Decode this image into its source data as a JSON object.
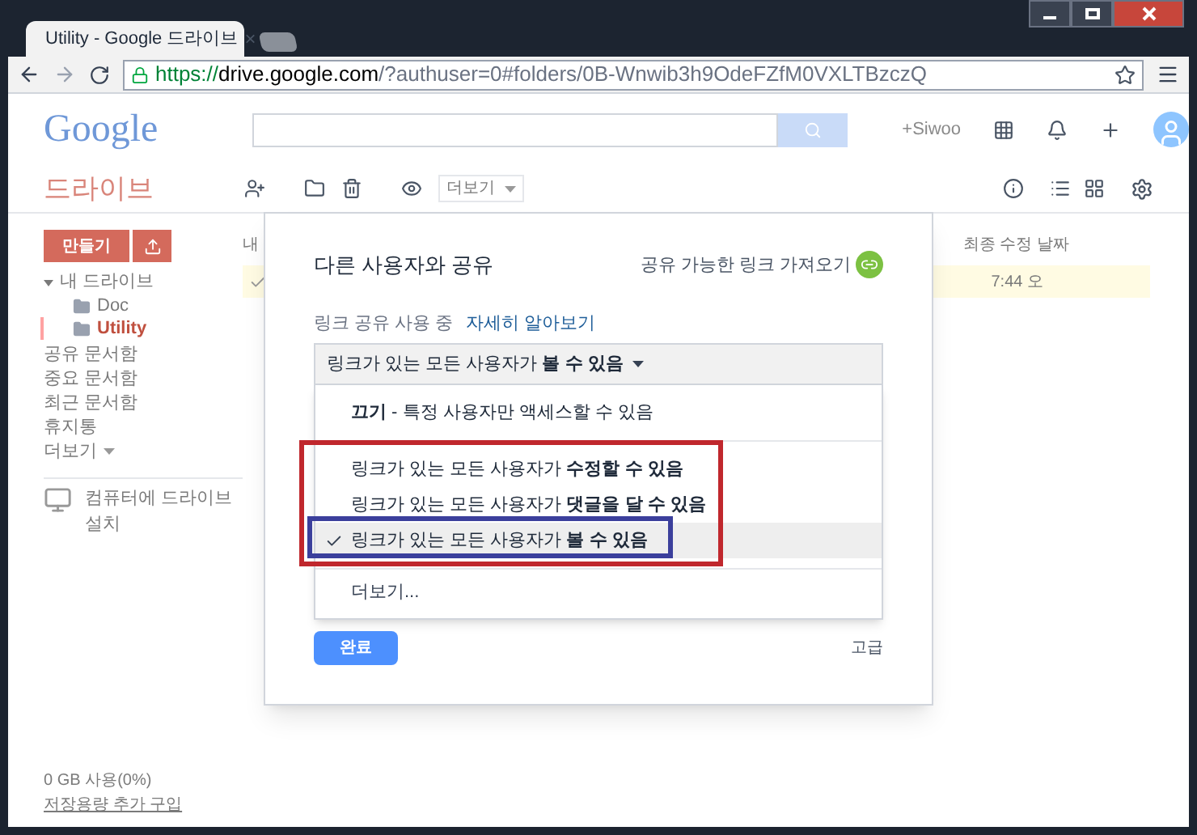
{
  "browser": {
    "tab_title": "Utility - Google 드라이브",
    "tab_close": "×",
    "url": {
      "scheme": "https://",
      "host": "drive.google.com",
      "path": "/?authuser=0#folders/0B-Wnwib3h9OdeFZfM0VXLTBzczQ"
    }
  },
  "header": {
    "logo": "Google",
    "user": "+Siwoo"
  },
  "toolbar": {
    "title": "드라이브",
    "more": "더보기"
  },
  "sidebar": {
    "create": "만들기",
    "tree": [
      {
        "label": "내 드라이브",
        "expanded": true,
        "children": [
          {
            "label": "Doc",
            "selected": false
          },
          {
            "label": "Utility",
            "selected": true
          }
        ]
      }
    ],
    "items": [
      "공유 문서함",
      "중요 문서함",
      "최근 문서함",
      "휴지통"
    ],
    "more": "더보기",
    "install": "컴퓨터에 드라이브 설치",
    "storage": "0 GB 사용(0%)",
    "buy_storage": "저장용량 추가 구입"
  },
  "file_list": {
    "column_1": "내",
    "modified_header": "최종 수정 날짜",
    "rows": [
      {
        "modified": "7:44 오",
        "selected": true
      }
    ]
  },
  "dialog": {
    "title": "다른 사용자와 공유",
    "get_link": "공유 가능한 링크 가져오기",
    "status": "링크 공유 사용 중",
    "learn_more": "자세히 알아보기",
    "dropdown": {
      "value": "링크가 있는 모든 사용자가 **볼 수 있음**",
      "expanded": true
    },
    "options": [
      {
        "label": "**끄기** - 특정 사용자만 액세스할 수 있음",
        "selected": false
      },
      {
        "label": "링크가 있는 모든 사용자가 **수정할 수 있음**",
        "selected": false
      },
      {
        "label": "링크가 있는 모든 사용자가 **댓글을 달 수 있음**",
        "selected": false
      },
      {
        "label": "링크가 있는 모든 사용자가 **볼 수 있음**",
        "selected": true
      }
    ],
    "more": "더보기...",
    "done": "완료",
    "advanced": "고급"
  }
}
